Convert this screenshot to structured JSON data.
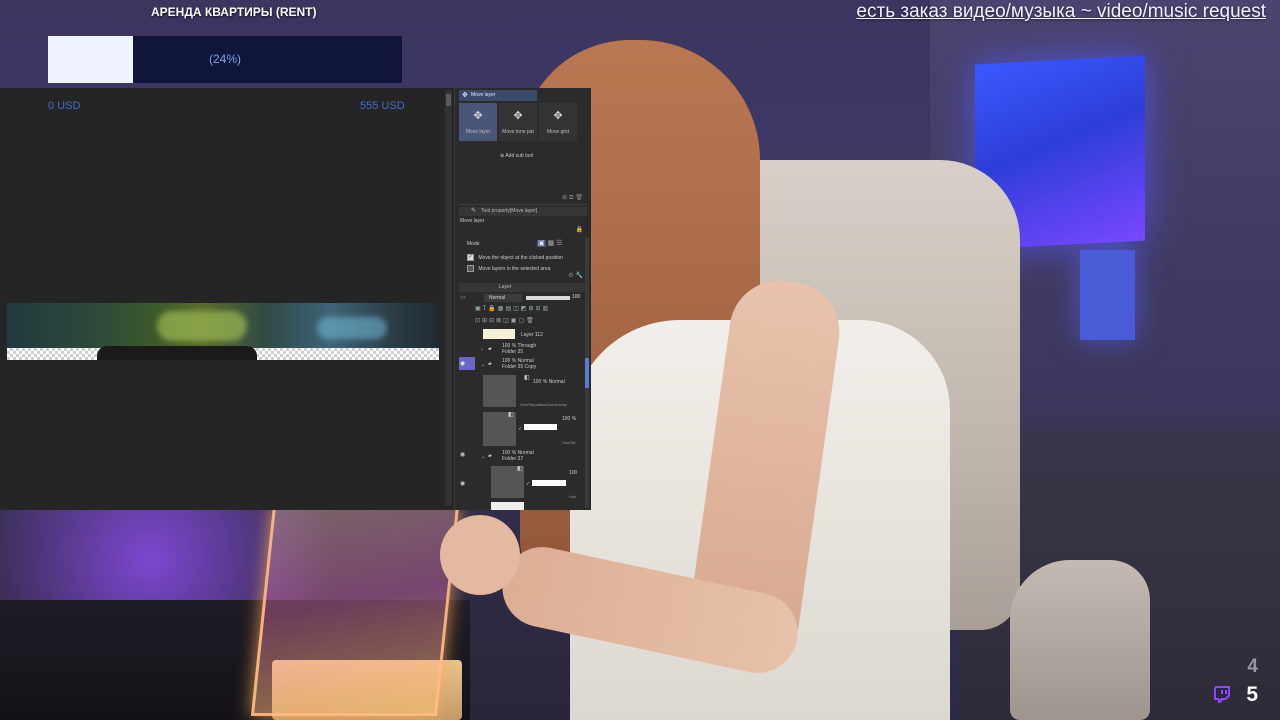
{
  "overlay": {
    "goal_title": "АРЕНДА КВАРТИРЫ (RENT)",
    "goal_progress_percent": 24,
    "goal_percent_label": "(24%)",
    "goal_min": "0 USD",
    "goal_max": "555 USD",
    "request_text": "есть заказ видео/музыка ~ video/music request",
    "viewer_count_prev": "4",
    "viewer_count": "5"
  },
  "tool_panel": {
    "tab_label": "Move layer",
    "tools": [
      {
        "label": "Move layer",
        "icon": "move-icon",
        "active": true
      },
      {
        "label": "Move tone pat",
        "icon": "move-icon",
        "active": false
      },
      {
        "label": "Move grid",
        "icon": "move-icon",
        "active": false
      }
    ],
    "add_sub_tool": "Add sub tool",
    "property_header": "Tool property[Move layer]",
    "property_name": "Move layer",
    "mode_label": "Mode",
    "option_1": "Move the object at the clicked position",
    "option_2": "Move layers in the selected area"
  },
  "layer_panel": {
    "header": "Layer",
    "blend_mode": "Normal",
    "opacity": "100",
    "layers": [
      {
        "name": "Layer 112"
      },
      {
        "name": "100 % Through",
        "sub": "Folder 35"
      },
      {
        "name": "100 % Normal",
        "sub": "Folder 35 Copy"
      },
      {
        "name": "100 % Normal",
        "sub": "Hue/Saturation/Luminosity"
      },
      {
        "name": "100 %",
        "sub": "Hue/Sa"
      },
      {
        "name": "100 % Normal",
        "sub": "Folder 37"
      },
      {
        "name": "100",
        "sub": "Hue"
      }
    ]
  },
  "colors": {
    "goal_fill": "#eef3ff",
    "goal_track": "#10163a",
    "canvas_bg": "#252525",
    "panel_bg": "#2b2b2b",
    "accent": "#4a5678",
    "twitch_purple": "#9146ff"
  }
}
